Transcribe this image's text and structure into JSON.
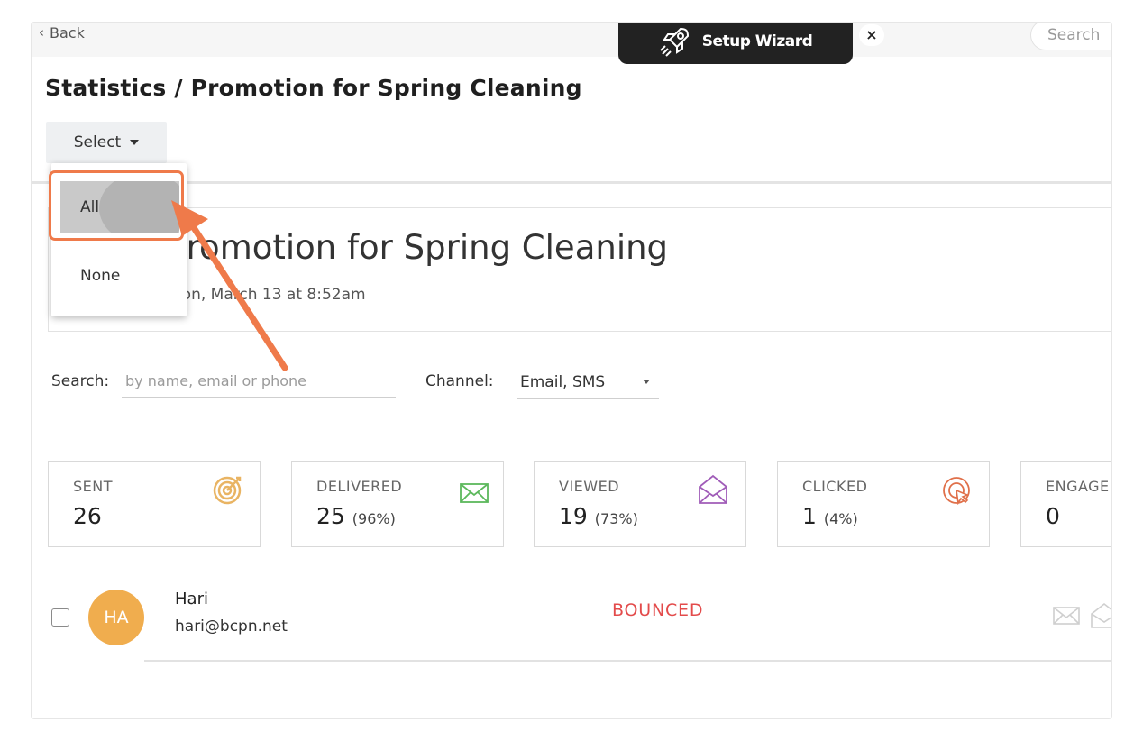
{
  "topbar": {
    "back_label": "Back",
    "wizard_label": "Setup Wizard",
    "close_label": "×",
    "search_placeholder": "Search"
  },
  "page": {
    "title": "Statistics / Promotion for Spring Cleaning",
    "select_label": "Select"
  },
  "dropdown": {
    "options": [
      "All",
      "None"
    ],
    "highlighted": "All"
  },
  "campaign": {
    "title_visible": "Promotion for Spring Cleaning",
    "date_visible": "Mon, March 13 at 8:52am"
  },
  "filters": {
    "search_label": "Search:",
    "search_placeholder": "by name, email or phone",
    "channel_label": "Channel:",
    "channel_value": "Email, SMS"
  },
  "stats": [
    {
      "label": "SENT",
      "value": "26",
      "pct": "",
      "icon": "target-icon"
    },
    {
      "label": "DELIVERED",
      "value": "25",
      "pct": "(96%)",
      "icon": "envelope-icon"
    },
    {
      "label": "VIEWED",
      "value": "19",
      "pct": "(73%)",
      "icon": "open-envelope-icon"
    },
    {
      "label": "CLICKED",
      "value": "1",
      "pct": "(4%)",
      "icon": "click-target-icon"
    },
    {
      "label": "ENGAGED",
      "value": "0",
      "pct": "",
      "icon": ""
    }
  ],
  "contacts": [
    {
      "initials": "HA",
      "name": "Hari",
      "email": "hari@bcpn.net",
      "status": "BOUNCED"
    }
  ],
  "colors": {
    "accent_orange": "#ef7a4a",
    "avatar": "#f0ad4e",
    "bounced": "#e34b4b",
    "sent_icon": "#e9b463",
    "delivered_icon": "#5cb85c",
    "viewed_icon": "#a05cb8",
    "clicked_icon": "#e0704a"
  }
}
